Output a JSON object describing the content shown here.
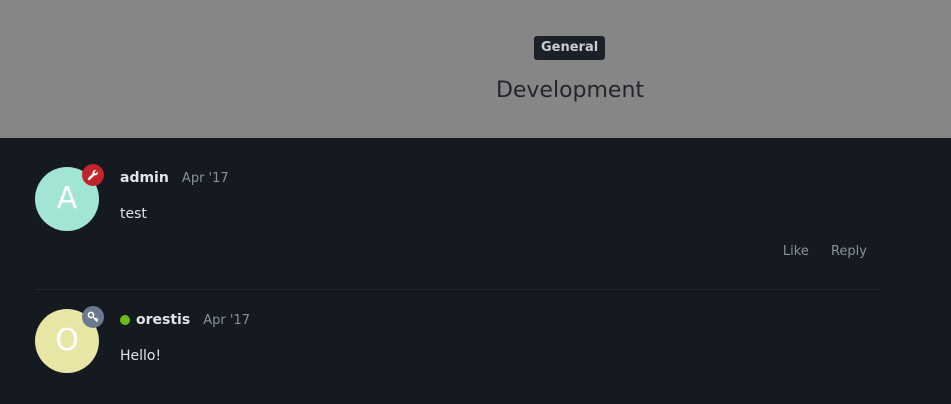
{
  "topic": {
    "category": "General",
    "title": "Development"
  },
  "posts": [
    {
      "avatar_letter": "A",
      "avatar_color": "#a3e5d4",
      "badge_icon": "wrench-icon",
      "badge_color": "#c0262b",
      "username": "admin",
      "date": "Apr '17",
      "body": "test",
      "like_label": "Like",
      "reply_label": "Reply"
    },
    {
      "avatar_letter": "O",
      "avatar_color": "#e8e6a4",
      "badge_icon": "key-icon",
      "badge_color": "#6b7891",
      "online_color": "#6bbd18",
      "username": "orestis",
      "date": "Apr '17",
      "body": "Hello!"
    }
  ]
}
